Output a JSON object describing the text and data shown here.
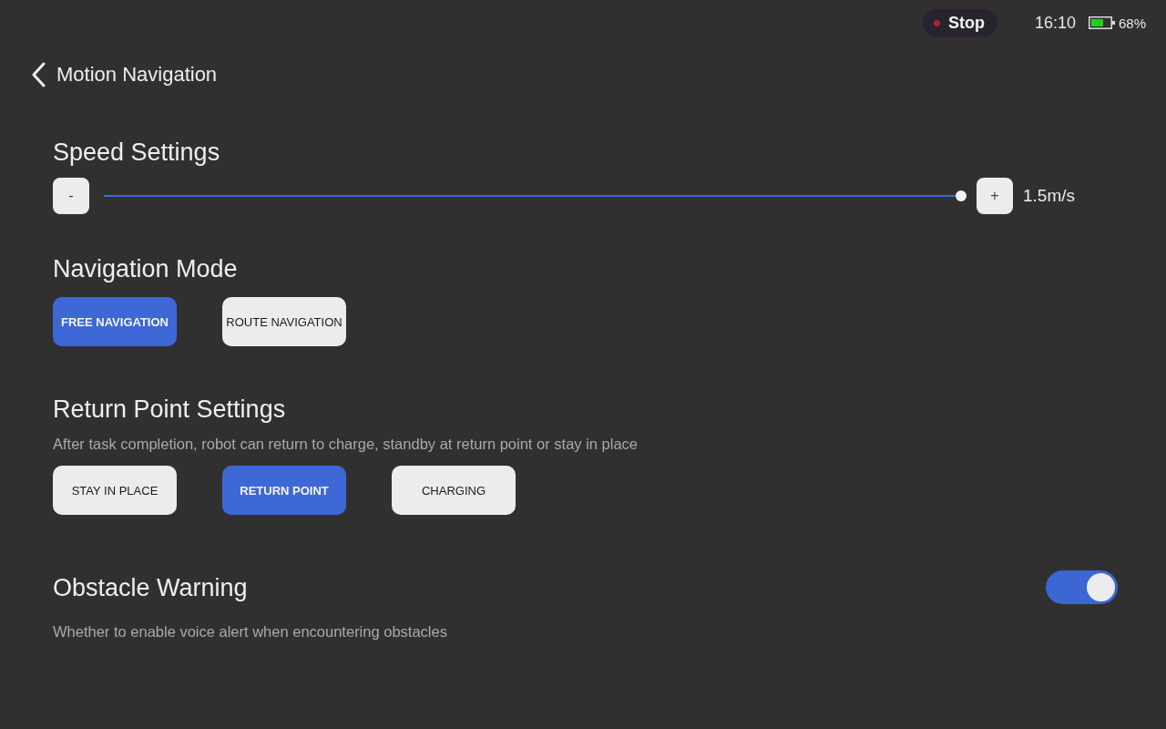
{
  "status_bar": {
    "stop_button": {
      "label": "Stop"
    },
    "time": "16:10",
    "battery": "68%"
  },
  "header": {
    "title": "Motion Navigation"
  },
  "speed_settings": {
    "title": "Speed Settings",
    "decrease": "-",
    "increase": "+",
    "level": 1,
    "reading": "1.5m/s"
  },
  "navigation_mode": {
    "title": "Navigation Mode",
    "options": [
      {
        "label": "FREE NAVIGATION",
        "selected": true
      },
      {
        "label": "ROUTE NAVIGATION",
        "selected": false
      }
    ]
  },
  "return_point_settings": {
    "title": "Return Point Settings",
    "description": "After task completion, robot can return to charge, standby at return point or stay in place",
    "options": [
      {
        "label": "STAY IN PLACE",
        "selected": false
      },
      {
        "label": "RETURN POINT",
        "selected": true
      },
      {
        "label": "CHARGING",
        "selected": false
      }
    ]
  },
  "obstacle_warning": {
    "title": "Obstacle Warning",
    "on": true,
    "description": "Whether to enable voice alert when encountering obstacles"
  }
}
